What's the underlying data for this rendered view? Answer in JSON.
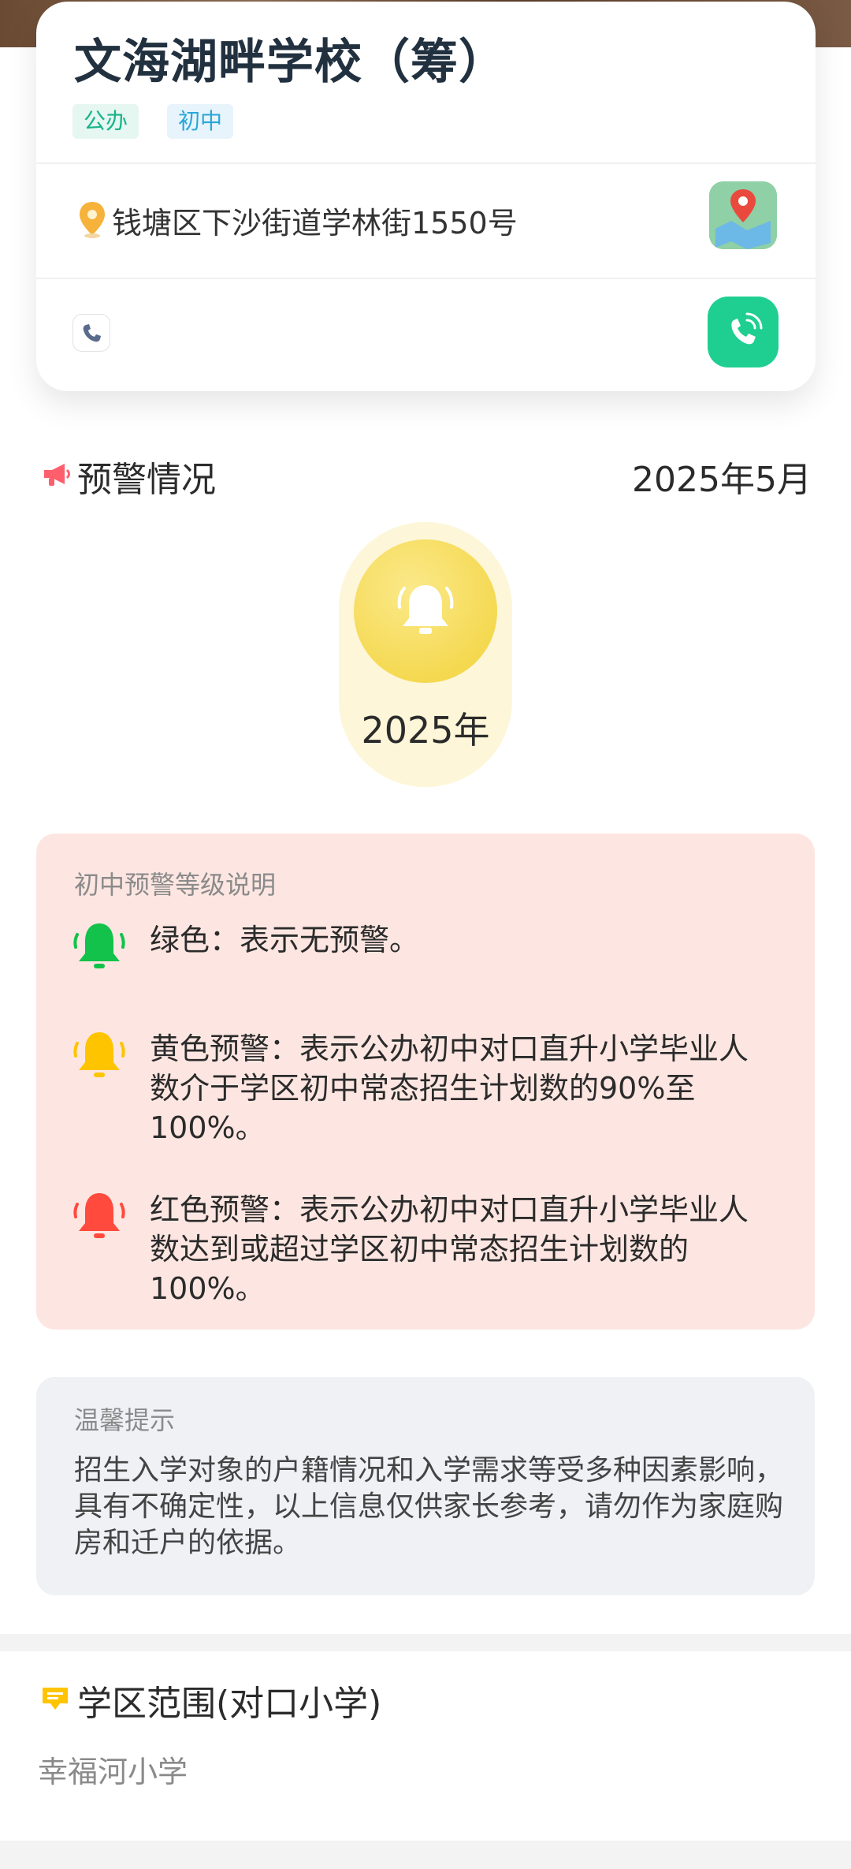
{
  "school": {
    "name": "文海湖畔学校（筹）",
    "tags": [
      "公办",
      "初中"
    ],
    "address": "钱塘区下沙街道学林街1550号"
  },
  "warning": {
    "title": "预警情况",
    "date": "2025年5月",
    "year": "2025年",
    "current_level_color": "#f2d23a"
  },
  "legend": {
    "title": "初中预警等级说明",
    "items": [
      {
        "color": "#12c24b",
        "text": "绿色：表示无预警。"
      },
      {
        "color": "#ffc400",
        "text": "黄色预警：表示公办初中对口直升小学毕业人数介于学区初中常态招生计划数的90%至100%。"
      },
      {
        "color": "#ff4a3d",
        "text": "红色预警：表示公办初中对口直升小学毕业人数达到或超过学区初中常态招生计划数的100%。"
      }
    ]
  },
  "tip": {
    "title": "温馨提示",
    "body": "招生入学对象的户籍情况和入学需求等受多种因素影响，具有不确定性，以上信息仅供家长参考，请勿作为家庭购房和迁户的依据。"
  },
  "zone": {
    "title": "学区范围(对口小学)",
    "school": "幸福河小学"
  },
  "colors": {
    "accent_green": "#1fcf91",
    "legend_bg": "#fde6e1",
    "tip_bg": "#eff1f5"
  }
}
